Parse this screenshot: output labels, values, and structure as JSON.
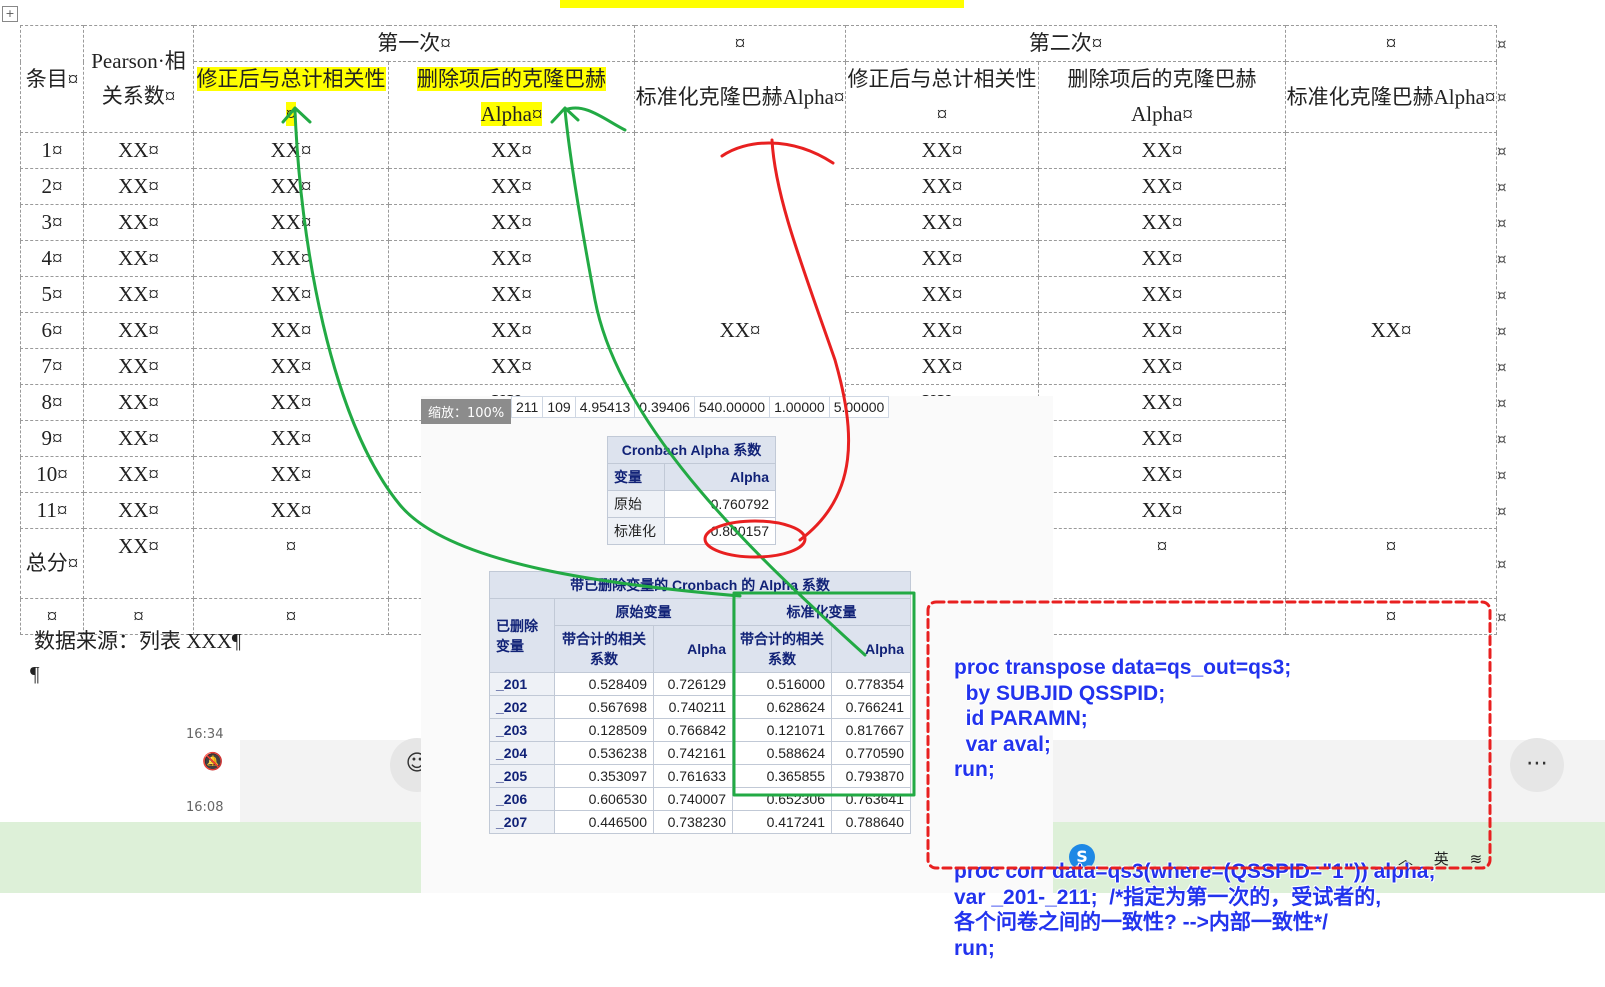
{
  "document": {
    "table": {
      "header1": {
        "item": "条目¤",
        "pearson": "Pearson·相关系数¤",
        "first": "第一次¤",
        "blank": "¤",
        "second": "第二次¤"
      },
      "header2": [
        "修正后与总计相关性¤",
        "删除项后的克隆巴赫Alpha¤",
        "标准化克隆巴赫Alpha¤",
        "修正后与总计相关性¤",
        "删除项后的克隆巴赫Alpha¤",
        "标准化克隆巴赫Alpha¤"
      ],
      "rows": [
        {
          "item": "1¤",
          "pearson": "XX¤",
          "c1": "XX¤",
          "c2": "XX¤",
          "c4": "XX¤",
          "c5": "XX¤"
        },
        {
          "item": "2¤",
          "pearson": "XX¤",
          "c1": "XX¤",
          "c2": "XX¤",
          "c4": "XX¤",
          "c5": "XX¤"
        },
        {
          "item": "3¤",
          "pearson": "XX¤",
          "c1": "XX¤",
          "c2": "XX¤",
          "c4": "XX¤",
          "c5": "XX¤"
        },
        {
          "item": "4¤",
          "pearson": "XX¤",
          "c1": "XX¤",
          "c2": "XX¤",
          "c4": "XX¤",
          "c5": "XX¤"
        },
        {
          "item": "5¤",
          "pearson": "XX¤",
          "c1": "XX¤",
          "c2": "XX¤",
          "c4": "XX¤",
          "c5": "XX¤"
        },
        {
          "item": "6¤",
          "pearson": "XX¤",
          "c1": "XX¤",
          "c2": "XX¤",
          "c4": "XX¤",
          "c5": "XX¤"
        },
        {
          "item": "7¤",
          "pearson": "XX¤",
          "c1": "XX¤",
          "c2": "XX¤",
          "c4": "XX¤",
          "c5": "XX¤"
        },
        {
          "item": "8¤",
          "pearson": "XX¤",
          "c1": "XX¤",
          "c2": "XX¤",
          "c4": "XX¤",
          "c5": "XX¤"
        },
        {
          "item": "9¤",
          "pearson": "XX¤",
          "c1": "XX¤",
          "c2": "",
          "c4": "",
          "c5": "XX¤"
        },
        {
          "item": "10¤",
          "pearson": "XX¤",
          "c1": "XX¤",
          "c2": "",
          "c4": "",
          "c5": "XX¤"
        },
        {
          "item": "11¤",
          "pearson": "XX¤",
          "c1": "XX¤",
          "c2": "",
          "c4": "",
          "c5": "XX¤"
        }
      ],
      "std_first": "XX¤",
      "std_second": "XX¤",
      "total": {
        "item": "总分¤",
        "pearson": "XX¤",
        "c1": "¤",
        "c5": "¤",
        "c6": "¤"
      },
      "last": {
        "item": "¤",
        "pearson": "¤",
        "c1": "¤",
        "c6": "¤"
      }
    },
    "source": "数据来源：列表 XXX¶",
    "paragraph": "¶",
    "right_mark": "¤"
  },
  "chat": {
    "time1": "16:34",
    "time2": "16:08"
  },
  "sas": {
    "zoom": "缩放：100%",
    "top_row": [
      "211",
      "109",
      "4.95413",
      "0.39406",
      "540.00000",
      "1.00000",
      "5.00000"
    ],
    "cronbach": {
      "title": "Cronbach Alpha 系数",
      "col_var": "变量",
      "col_alpha": "Alpha",
      "rows": [
        {
          "var": "原始",
          "alpha": "0.760792"
        },
        {
          "var": "标准化",
          "alpha": "0.800157"
        }
      ]
    },
    "deleted": {
      "title": "带已删除变量的 Cronbach 的 Alpha 系数",
      "raw": "原始变量",
      "std": "标准化变量",
      "deleted_var": "已删除变量",
      "corr": "带合计的相关系数",
      "alpha": "Alpha",
      "rows": [
        {
          "var": "_201",
          "rc": "0.528409",
          "ra": "0.726129",
          "sc": "0.516000",
          "sa": "0.778354"
        },
        {
          "var": "_202",
          "rc": "0.567698",
          "ra": "0.740211",
          "sc": "0.628624",
          "sa": "0.766241"
        },
        {
          "var": "_203",
          "rc": "0.128509",
          "ra": "0.766842",
          "sc": "0.121071",
          "sa": "0.817667"
        },
        {
          "var": "_204",
          "rc": "0.536238",
          "ra": "0.742161",
          "sc": "0.588624",
          "sa": "0.770590"
        },
        {
          "var": "_205",
          "rc": "0.353097",
          "ra": "0.761633",
          "sc": "0.365855",
          "sa": "0.793870"
        },
        {
          "var": "_206",
          "rc": "0.606530",
          "ra": "0.740007",
          "sc": "0.652306",
          "sa": "0.763641"
        },
        {
          "var": "_207",
          "rc": "0.446500",
          "ra": "0.738230",
          "sc": "0.417241",
          "sa": "0.788640"
        }
      ]
    }
  },
  "code": [
    "proc transpose data=qs_out=qs3;",
    "  by SUBJID QSSPID;",
    "  id PARAMN;",
    "  var aval;",
    "run;",
    "",
    "proc corr data=qs3(where=(QSSPID=\"1\")) alpha;",
    "var _201-_211;  /*指定为第一次的，受试者的,",
    "各个问卷之间的一致性? -->内部一致性*/",
    "run;"
  ],
  "tray": {
    "ime": "英",
    "skype": "S"
  },
  "icons": {
    "emoji": "smile-icon",
    "more": "more-icon"
  }
}
